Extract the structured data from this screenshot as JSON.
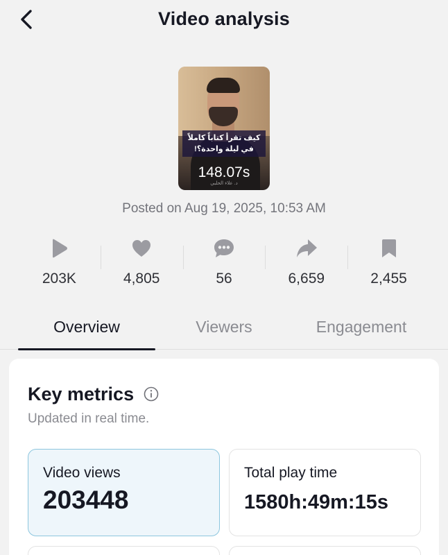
{
  "header": {
    "title": "Video analysis",
    "back_icon": "chevron-left-icon"
  },
  "video": {
    "duration": "148.07s",
    "caption_line1": "كيف تقرأ كتاباً كاملاً",
    "caption_line2": "في ليلة واحدة؟!",
    "credit": "د. علاء الحلبي",
    "posted": "Posted on Aug 19, 2025, 10:53 AM"
  },
  "stats": [
    {
      "icon": "play-icon",
      "value": "203K"
    },
    {
      "icon": "heart-icon",
      "value": "4,805"
    },
    {
      "icon": "comment-icon",
      "value": "56"
    },
    {
      "icon": "share-icon",
      "value": "6,659"
    },
    {
      "icon": "bookmark-icon",
      "value": "2,455"
    }
  ],
  "tabs": [
    {
      "label": "Overview",
      "active": true
    },
    {
      "label": "Viewers",
      "active": false
    },
    {
      "label": "Engagement",
      "active": false
    }
  ],
  "key_metrics": {
    "title": "Key metrics",
    "subtitle": "Updated in real time.",
    "cards": [
      {
        "label": "Video views",
        "value": "203448",
        "selected": true
      },
      {
        "label": "Total play time",
        "value": "1580h:49m:15s",
        "selected": false
      }
    ]
  },
  "colors": {
    "background": "#f2f2f2",
    "text": "#161823",
    "muted": "#8a8b91",
    "icon": "#9b9ba1",
    "selected_border": "#8cc6de",
    "selected_bg": "#eef6fb"
  }
}
